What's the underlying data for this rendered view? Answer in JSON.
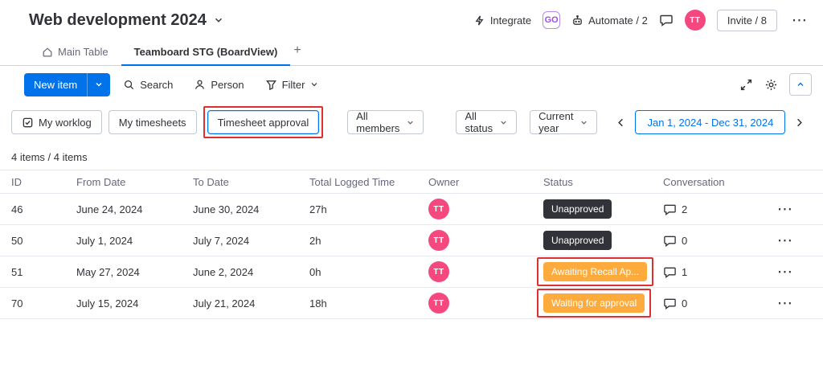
{
  "header": {
    "title": "Web development 2024",
    "integrate_label": "Integrate",
    "automate_label": "Automate / 2",
    "invite_label": "Invite / 8",
    "avatar_initials": "TT",
    "hex_badge": "GO"
  },
  "tabs": {
    "main_table": "Main Table",
    "teamboard": "Teamboard STG (BoardView)",
    "add": "+"
  },
  "toolbar": {
    "new_item": "New item",
    "search": "Search",
    "person": "Person",
    "filter": "Filter"
  },
  "filters": {
    "my_worklog": "My worklog",
    "my_timesheets": "My timesheets",
    "timesheet_approval": "Timesheet approval",
    "all_members": "All members",
    "all_status": "All status",
    "current_year": "Current year",
    "date_range": "Jan 1, 2024 - Dec 31, 2024"
  },
  "counts": "4 items / 4 items",
  "table": {
    "columns": {
      "id": "ID",
      "from": "From Date",
      "to": "To Date",
      "time": "Total Logged Time",
      "owner": "Owner",
      "status": "Status",
      "conversation": "Conversation"
    },
    "rows": [
      {
        "id": "46",
        "from": "June 24, 2024",
        "to": "June 30, 2024",
        "time": "27h",
        "owner": "TT",
        "status": "Unapproved",
        "status_type": "dark",
        "conversation": "2",
        "highlight": false
      },
      {
        "id": "50",
        "from": "July 1, 2024",
        "to": "July 7, 2024",
        "time": "2h",
        "owner": "TT",
        "status": "Unapproved",
        "status_type": "dark",
        "conversation": "0",
        "highlight": false
      },
      {
        "id": "51",
        "from": "May 27, 2024",
        "to": "June 2, 2024",
        "time": "0h",
        "owner": "TT",
        "status": "Awaiting Recall Ap...",
        "status_type": "warning",
        "conversation": "1",
        "highlight": true
      },
      {
        "id": "70",
        "from": "July 15, 2024",
        "to": "July 21, 2024",
        "time": "18h",
        "owner": "TT",
        "status": "Waiting for approval",
        "status_type": "warning",
        "conversation": "0",
        "highlight": true
      }
    ]
  },
  "colors": {
    "accent": "#0073ea",
    "avatar": "#f5487f",
    "dark": "#323338",
    "warning": "#fdab3d",
    "annotation": "#e02f2f"
  }
}
